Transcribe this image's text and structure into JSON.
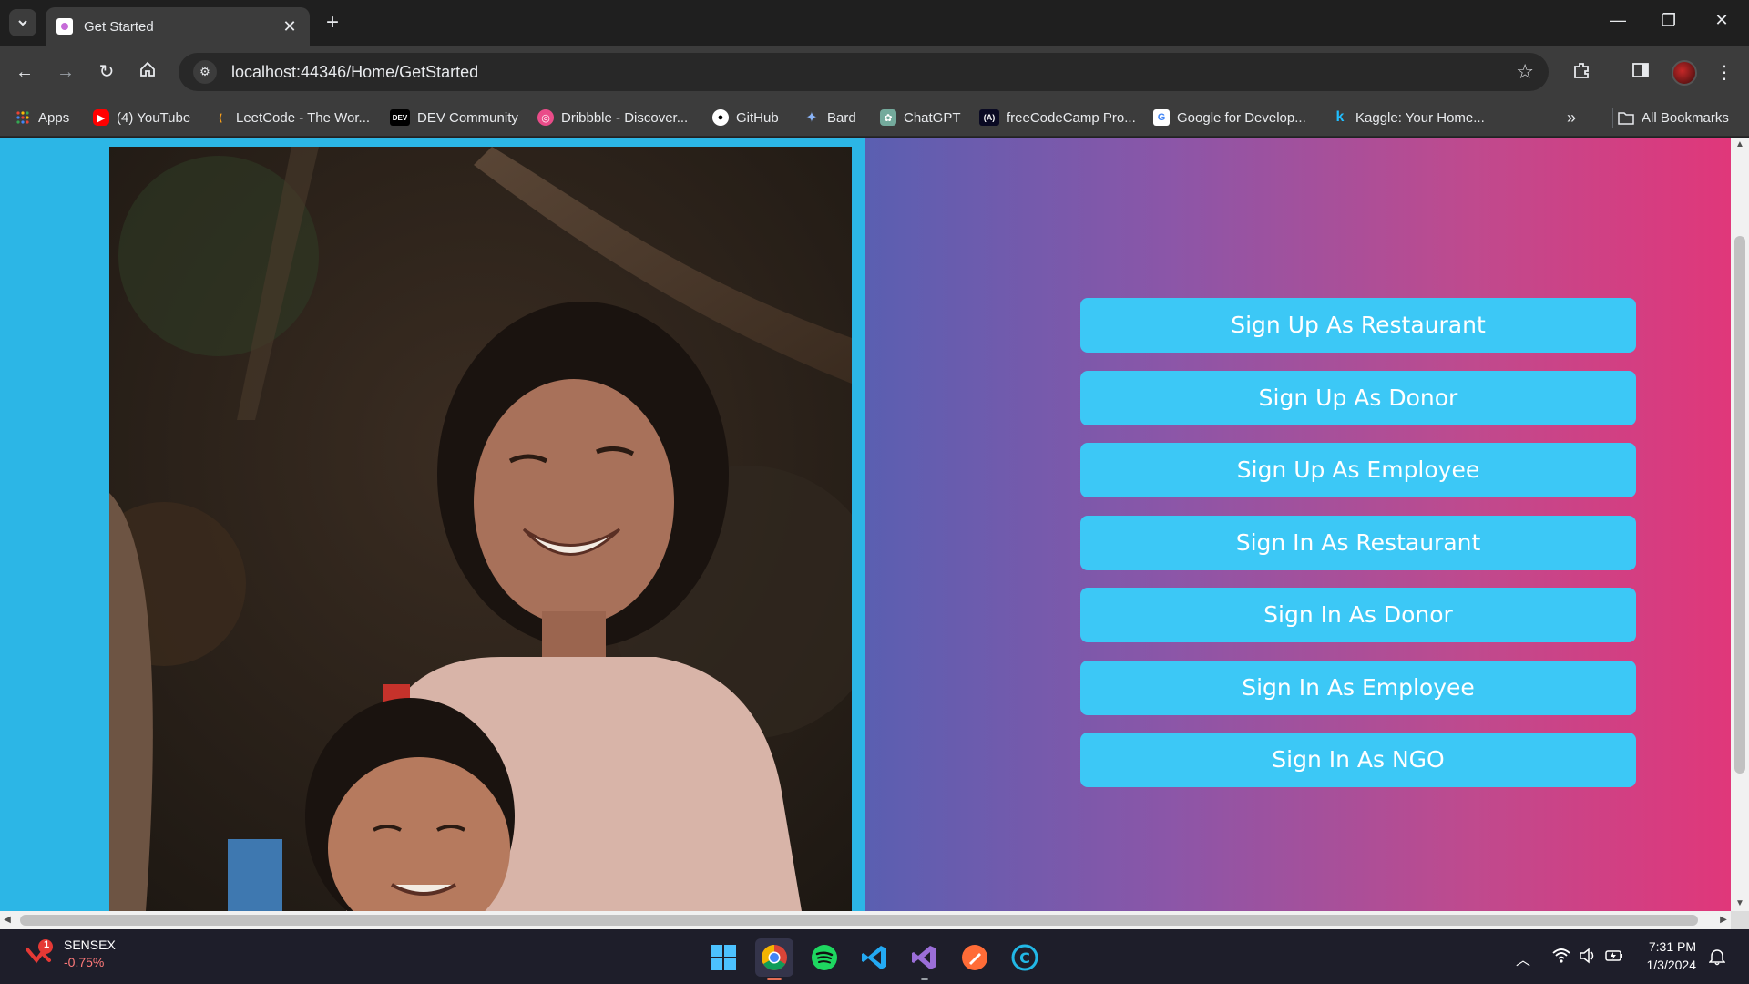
{
  "browser": {
    "tab": {
      "title": "Get Started"
    },
    "omnibox": {
      "url": "localhost:44346/Home/GetStarted"
    },
    "bookmarks": [
      {
        "label": "Apps",
        "icon": "apps-grid-icon"
      },
      {
        "label": "(4) YouTube",
        "icon": "youtube-icon"
      },
      {
        "label": "LeetCode - The Wor...",
        "icon": "leetcode-icon"
      },
      {
        "label": "DEV Community",
        "icon": "dev-icon"
      },
      {
        "label": "Dribbble - Discover...",
        "icon": "dribbble-icon"
      },
      {
        "label": "GitHub",
        "icon": "github-icon"
      },
      {
        "label": "Bard",
        "icon": "bard-icon"
      },
      {
        "label": "ChatGPT",
        "icon": "chatgpt-icon"
      },
      {
        "label": "freeCodeCamp Pro...",
        "icon": "freecodecamp-icon"
      },
      {
        "label": "Google for Develop...",
        "icon": "google-icon"
      },
      {
        "label": "Kaggle: Your Home...",
        "icon": "kaggle-icon"
      }
    ],
    "all_bookmarks": "All Bookmarks",
    "overflow": "»"
  },
  "page": {
    "background_color": "#2cb6e6",
    "gradient_colors": [
      "#5a5fb1",
      "#8b56a8",
      "#bf4a8e",
      "#e0377a"
    ],
    "button_color": "#3cc8f6",
    "buttons": [
      "Sign Up As Restaurant",
      "Sign Up As Donor",
      "Sign Up As Employee",
      "Sign In As Restaurant",
      "Sign In As Donor",
      "Sign In As Employee",
      "Sign In As NGO"
    ]
  },
  "taskbar": {
    "widget": {
      "name": "SENSEX",
      "value": "-0.75%",
      "badge": "1"
    },
    "apps": [
      "windows-start-icon",
      "chrome-icon",
      "spotify-icon",
      "vscode-icon",
      "visual-studio-icon",
      "postman-icon",
      "cursor-c-icon"
    ],
    "clock": {
      "time": "7:31 PM",
      "date": "1/3/2024"
    }
  }
}
